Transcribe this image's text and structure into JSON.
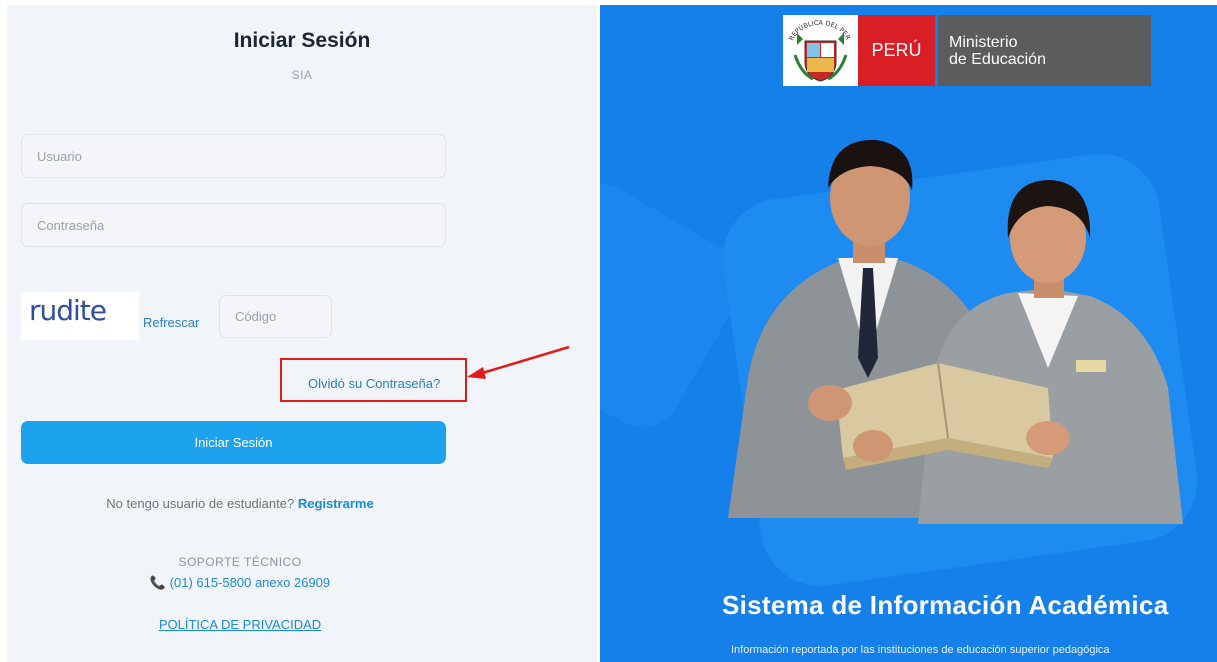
{
  "login": {
    "title": "Iniciar Sesión",
    "subtitle": "SIA",
    "username_placeholder": "Usuario",
    "password_placeholder": "Contraseña",
    "captcha_text": "rudite",
    "refresh_label": "Refrescar",
    "code_placeholder": "Código",
    "forgot_label": "Olvidó su Contraseña?",
    "submit_label": "Iniciar Sesión",
    "register_prompt": "No tengo usuario de estudiante?",
    "register_link": "Registrarme",
    "support_title": "SOPORTE TÉCNICO",
    "support_phone": "(01) 615-5800 anexo 26909",
    "privacy_label": "POLÍTICA DE PRIVACIDAD"
  },
  "brand": {
    "peru_label": "PERÚ",
    "ministry_line1": "Ministerio",
    "ministry_line2": "de Educación",
    "shield_label": "REPÚBLICA DEL PERÚ"
  },
  "hero": {
    "title": "Sistema de Información Académica",
    "subtitle": "Información reportada por las instituciones de educación superior pedagógica"
  },
  "colors": {
    "primary_button": "#1da3ee",
    "link": "#1d8ad6",
    "hero_background": "#1680ea",
    "annotation_red": "#e11a1a"
  }
}
